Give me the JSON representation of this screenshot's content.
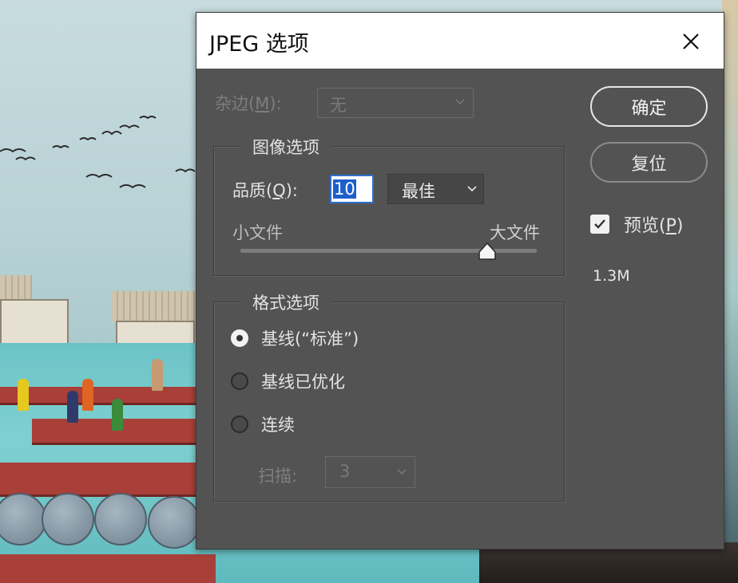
{
  "dialog": {
    "title": "JPEG 选项",
    "close_label": "close"
  },
  "matte": {
    "label_prefix": "杂边(",
    "label_key": "M",
    "label_suffix": "):",
    "value": "无"
  },
  "image_options": {
    "legend": "图像选项",
    "quality_label_prefix": "品质(",
    "quality_label_key": "Q",
    "quality_label_suffix": "):",
    "quality_value": "10",
    "quality_preset": "最佳",
    "small_file": "小文件",
    "large_file": "大文件",
    "slider_level_fraction": 0.83
  },
  "format_options": {
    "legend": "格式选项",
    "radios": [
      {
        "label": "基线(“标准”)",
        "selected": true
      },
      {
        "label": "基线已优化",
        "selected": false
      },
      {
        "label": "连续",
        "selected": false
      }
    ],
    "scans_label": "扫描:",
    "scans_value": "3"
  },
  "buttons": {
    "ok": "确定",
    "reset": "复位"
  },
  "preview": {
    "label_prefix": "预览(",
    "label_key": "P",
    "label_suffix": ")",
    "checked": true
  },
  "file_size": "1.3M",
  "colors": {
    "dialog_bg": "#535353",
    "titlebar_bg": "#ffffff",
    "selection_blue": "#1d5fc9"
  },
  "icons": [
    "close-icon",
    "chevron-down-icon",
    "checkmark-icon",
    "slider-thumb-icon"
  ]
}
